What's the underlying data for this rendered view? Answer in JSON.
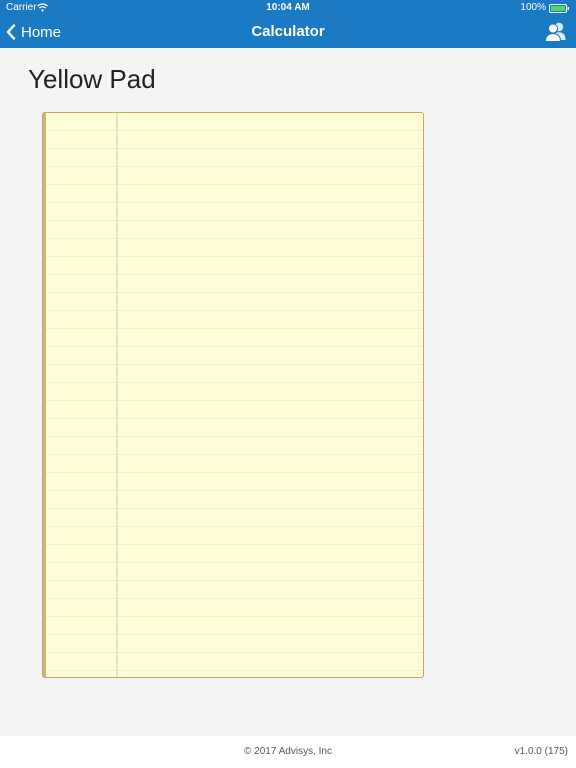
{
  "status_bar": {
    "carrier": "Carrier",
    "time": "10:04 AM",
    "battery": "100%",
    "battery_color": "#4cd964"
  },
  "nav": {
    "back_label": "Home",
    "title": "Calculator",
    "back_icon": "chevron-left-icon",
    "right_icon": "contacts-icon",
    "bar_color": "#1a7ac4"
  },
  "page": {
    "title": "Yellow Pad"
  },
  "pad": {
    "paper_color": "#fefdd8",
    "line_color": "#edefd4",
    "margin_color": "#efe0b4"
  },
  "footer": {
    "copyright": "© 2017 Advisys, Inc",
    "version": "v1.0.0 (175)"
  }
}
